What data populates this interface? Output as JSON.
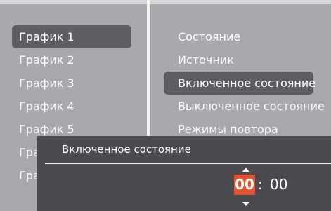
{
  "schedule_list": {
    "items": [
      {
        "label": "График 1",
        "selected": true
      },
      {
        "label": "График 2"
      },
      {
        "label": "График 3"
      },
      {
        "label": "График 4"
      },
      {
        "label": "График 5"
      },
      {
        "label": "Гра"
      },
      {
        "label": "Гра"
      }
    ]
  },
  "settings_menu": {
    "items": [
      {
        "label": "Состояние"
      },
      {
        "label": "Источник"
      },
      {
        "label": "Включенное состояние",
        "selected": true
      },
      {
        "label": "Выключенное состояние"
      },
      {
        "label": "Режимы повтора"
      }
    ]
  },
  "dialog": {
    "title": "Включенное состояние",
    "hours": "00",
    "separator": ":",
    "minutes": "00"
  },
  "colors": {
    "background": "#a9a8ac",
    "selection": "#5e5e62",
    "dialog": "#4b4a4e",
    "accent": "#e8512c"
  }
}
